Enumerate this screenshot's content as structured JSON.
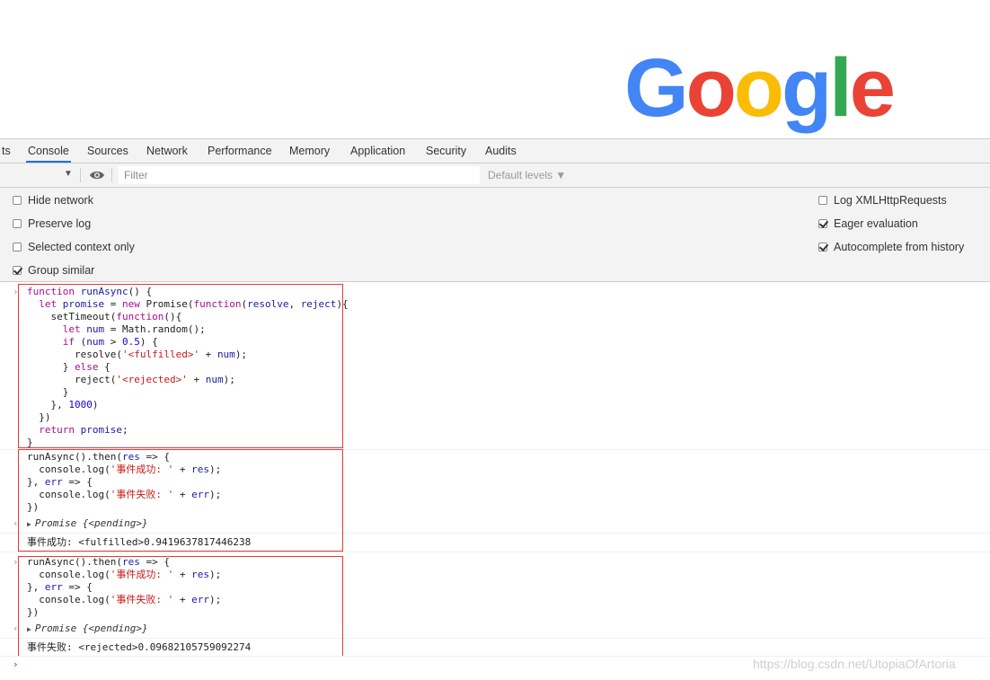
{
  "logo": {
    "letters": [
      {
        "ch": "G",
        "color": "#4285F4"
      },
      {
        "ch": "o",
        "color": "#EA4335"
      },
      {
        "ch": "o",
        "color": "#FBBC05"
      },
      {
        "ch": "g",
        "color": "#4285F4"
      },
      {
        "ch": "l",
        "color": "#34A853"
      },
      {
        "ch": "e",
        "color": "#EA4335"
      }
    ]
  },
  "tabs": [
    {
      "label": "ts"
    },
    {
      "label": "Console",
      "active": true
    },
    {
      "label": "Sources"
    },
    {
      "label": "Network"
    },
    {
      "label": "Performance"
    },
    {
      "label": "Memory"
    },
    {
      "label": "Application"
    },
    {
      "label": "Security"
    },
    {
      "label": "Audits"
    }
  ],
  "toolbar": {
    "context_arrow": "▼",
    "filter_placeholder": "Filter",
    "levels_label": "Default levels ▼"
  },
  "settings": {
    "left": [
      {
        "label": "Hide network",
        "checked": false
      },
      {
        "label": "Preserve log",
        "checked": false
      },
      {
        "label": "Selected context only",
        "checked": false
      },
      {
        "label": "Group similar",
        "checked": true
      }
    ],
    "right": [
      {
        "label": "Log XMLHttpRequests",
        "checked": false
      },
      {
        "label": "Eager evaluation",
        "checked": true
      },
      {
        "label": "Autocomplete from history",
        "checked": true
      }
    ]
  },
  "console": {
    "block1": [
      "function runAsync() {",
      "  let promise = new Promise(function(resolve, reject){",
      "    setTimeout(function(){",
      "      let num = Math.random();",
      "      if (num > 0.5) {",
      "        resolve('<fulfilled>' + num);",
      "      } else {",
      "        reject('<rejected>' + num);",
      "      }",
      "    }, 1000)",
      "  })",
      "  return promise;",
      "}"
    ],
    "block2": [
      "runAsync().then(res => {",
      "  console.log('事件成功: ' + res);",
      "}, err => {",
      "  console.log('事件失败: ' + err);",
      "})"
    ],
    "promise_label": "Promise {<pending>}",
    "output1": "事件成功: <fulfilled>0.9419637817446238",
    "block3": [
      "runAsync().then(res => {",
      "  console.log('事件成功: ' + res);",
      "}, err => {",
      "  console.log('事件失败: ' + err);",
      "})"
    ],
    "output2": "事件失败: <rejected>0.09682105759092274",
    "prompt": "›"
  },
  "watermark": "https://blog.csdn.net/UtopiaOfArtoria"
}
